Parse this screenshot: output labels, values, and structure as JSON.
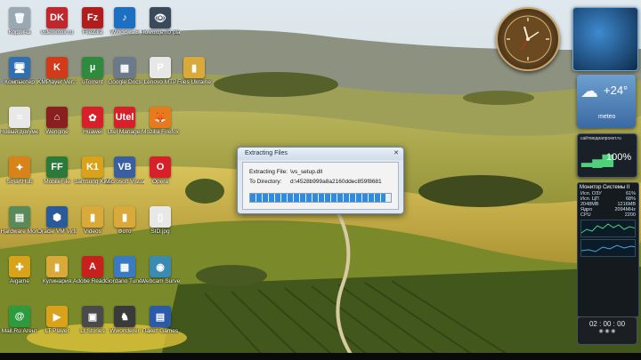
{
  "desktop_icons": [
    {
      "label": "Корзина",
      "name": "recycle-bin-icon",
      "color": "#9aa8b4",
      "glyph": "🗑"
    },
    {
      "label": "videokotik.ru",
      "name": "videokotik-icon",
      "color": "#c2262d",
      "glyph": "DK"
    },
    {
      "label": "FileZilla",
      "name": "filezilla-icon",
      "color": "#b11d1d",
      "glyph": "Fz"
    },
    {
      "label": "Windows 8",
      "name": "windows8-icon",
      "color": "#1d6fc2",
      "glyph": "♪"
    },
    {
      "label": "Помощь по plays",
      "name": "plays-help-icon",
      "color": "#3a4a5a",
      "glyph": "👁"
    },
    {
      "label": "Компьютер",
      "name": "computer-icon",
      "color": "#2f6fb2",
      "glyph": "🖥"
    },
    {
      "label": "KMPlayer Ver. 3",
      "name": "kmplayer-icon",
      "color": "#d23a1a",
      "glyph": "K"
    },
    {
      "label": "uTorrent",
      "name": "utorrent-icon",
      "color": "#2e8b3d",
      "glyph": "µ"
    },
    {
      "label": "Google Docs",
      "name": "calculator-icon",
      "color": "#6a7a8a",
      "glyph": "▦"
    },
    {
      "label": "Lenovo MTP",
      "name": "panel-icon",
      "color": "#e7e7e7",
      "glyph": "P"
    },
    {
      "label": "Files Ukraine",
      "name": "folder-icon",
      "color": "#d9a93a",
      "glyph": "▮"
    },
    {
      "label": "Новый документ",
      "name": "document-icon",
      "color": "#e8e8e8",
      "glyph": "≡"
    },
    {
      "label": "Wengine",
      "name": "wengine-icon",
      "color": "#8a1f1f",
      "glyph": "⌂"
    },
    {
      "label": "Huawei",
      "name": "huawei-icon",
      "color": "#d8202a",
      "glyph": "✿"
    },
    {
      "label": "Utel Manager",
      "name": "utel-icon",
      "color": "#d8202a",
      "glyph": "Utel"
    },
    {
      "label": "Mozilla Firefox",
      "name": "firefox-icon",
      "color": "#e87a1e",
      "glyph": "🦊"
    },
    {
      "label": "SmartHub",
      "name": "smarthub-icon",
      "color": "#d8831a",
      "glyph": "✦"
    },
    {
      "label": "MobileFile",
      "name": "mobilefile-icon",
      "color": "#2b7a3a",
      "glyph": "FF"
    },
    {
      "label": "Samsung Kies",
      "name": "kies-icon",
      "color": "#d8a21a",
      "glyph": "K1"
    },
    {
      "label": "Microsoft Visual Basic",
      "name": "vb-icon",
      "color": "#3a5fa0",
      "glyph": "VB"
    },
    {
      "label": "Opera",
      "name": "opera-icon",
      "color": "#d8202a",
      "glyph": "O"
    },
    {
      "label": "Hardware Mon",
      "name": "monitor-icon",
      "color": "#5a8a5a",
      "glyph": "▤"
    },
    {
      "label": "Oracle VM VirtualBox",
      "name": "virtualbox-icon",
      "color": "#2a5a9a",
      "glyph": "⬢"
    },
    {
      "label": "Videos",
      "name": "videos-folder-icon",
      "color": "#d9a93a",
      "glyph": "▮"
    },
    {
      "label": "Фото",
      "name": "photos-folder-icon",
      "color": "#d9a93a",
      "glyph": "▮"
    },
    {
      "label": "SID.jpg",
      "name": "file-icon",
      "color": "#e8e8e8",
      "glyph": "▯"
    },
    {
      "label": "Aigame",
      "name": "aigame-icon",
      "color": "#d8a21a",
      "glyph": "✚"
    },
    {
      "label": "Кулинария",
      "name": "book-icon",
      "color": "#d9a93a",
      "glyph": "▮"
    },
    {
      "label": "Adobe Reader XI",
      "name": "adobe-reader-icon",
      "color": "#c8201d",
      "glyph": "A"
    },
    {
      "label": "Gordano Tunes Ope",
      "name": "gordano-icon",
      "color": "#3a7ac2",
      "glyph": "▦"
    },
    {
      "label": "Webcam Surveyor",
      "name": "webcam-icon",
      "color": "#3a8ab2",
      "glyph": "◉"
    },
    {
      "label": "Mail.Ru Агент",
      "name": "mailru-icon",
      "color": "#2e9a3e",
      "glyph": "@"
    },
    {
      "label": "LT Player",
      "name": "player-icon",
      "color": "#d8a21a",
      "glyph": "▶"
    },
    {
      "label": "Lt Stories",
      "name": "stories-icon",
      "color": "#4a4a4a",
      "glyph": "▣"
    },
    {
      "label": "Wwonderer",
      "name": "wonderer-icon",
      "color": "#3a3a3a",
      "glyph": "♞"
    },
    {
      "label": "Пакет Games",
      "name": "games-icon",
      "color": "#2a5aa8",
      "glyph": "▤"
    }
  ],
  "dialog": {
    "title": "Extracting Files",
    "close_label": "✕",
    "file_label": "Extracting File:",
    "file_value": "\\vs_setup.dll",
    "dir_label": "To Directory:",
    "dir_value": "d:\\4528b999a8a2160ddec859f8681",
    "progress": 0.96
  },
  "gadgets": {
    "weather_temp": "+24°",
    "weather_city": "meteo",
    "signal_percent": "100%",
    "signal_label": "сайтмедиапроект.ru",
    "sysmon_title": "Монитор Системы II",
    "sysmon_rows": [
      {
        "k": "Исп. ОЗУ",
        "v": "61%"
      },
      {
        "k": "Исп. ЦП",
        "v": "68%"
      },
      {
        "k": "2048MB",
        "v": "1216MB"
      },
      {
        "k": "Ядро",
        "v": "2094MHz"
      },
      {
        "k": "CPU",
        "v": "2200"
      }
    ],
    "timer_value": "02 : 00 : 00"
  }
}
